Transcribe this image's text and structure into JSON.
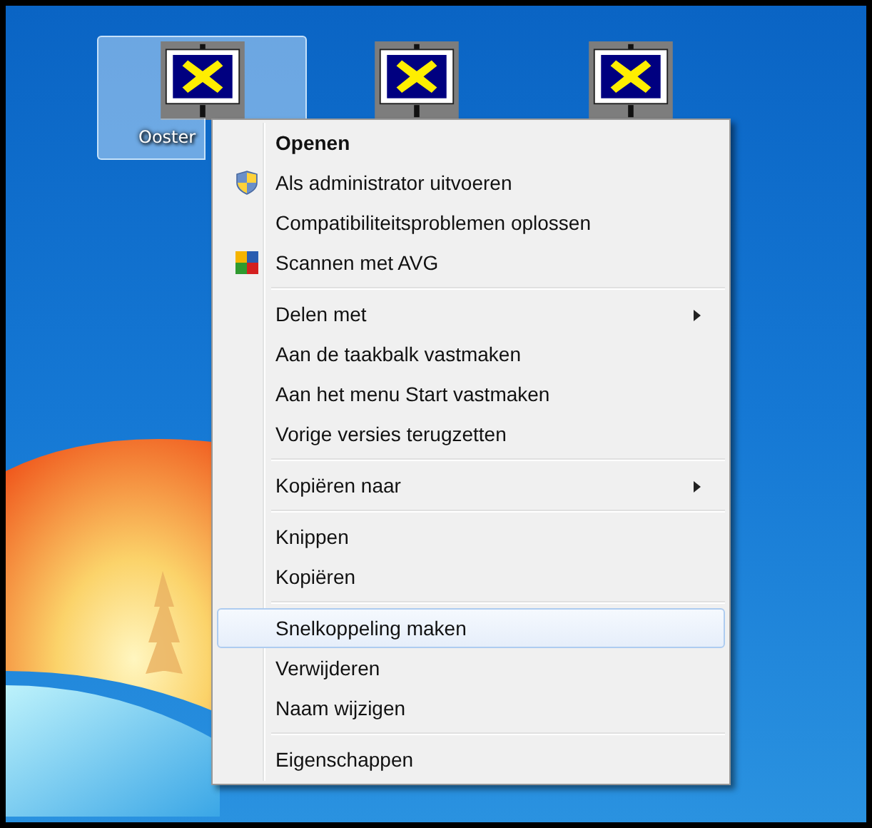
{
  "desktop_icons": [
    {
      "label": "Ooster",
      "selected": true
    },
    {
      "selected": false
    },
    {
      "selected": false
    }
  ],
  "context_menu": {
    "groups": [
      [
        {
          "label": "Openen",
          "kind": "plain",
          "default": true,
          "selected": false
        },
        {
          "label": "Als administrator uitvoeren",
          "kind": "shield",
          "selected": false
        },
        {
          "label": "Compatibiliteitsproblemen oplossen",
          "kind": "plain",
          "selected": false
        },
        {
          "label": "Scannen met AVG",
          "kind": "scan",
          "selected": false
        }
      ],
      [
        {
          "label": "Delen met",
          "kind": "plain",
          "submenu": true,
          "selected": false
        },
        {
          "label": "Aan de taakbalk vastmaken",
          "kind": "plain",
          "selected": false
        },
        {
          "label": "Aan het menu Start vastmaken",
          "kind": "plain",
          "selected": false
        },
        {
          "label": "Vorige versies terugzetten",
          "kind": "plain",
          "selected": false
        }
      ],
      [
        {
          "label": "Kopiëren naar",
          "kind": "plain",
          "submenu": true,
          "selected": false
        }
      ],
      [
        {
          "label": "Knippen",
          "kind": "plain",
          "selected": false
        },
        {
          "label": "Kopiëren",
          "kind": "plain",
          "selected": false
        }
      ],
      [
        {
          "label": "Snelkoppeling maken",
          "kind": "plain",
          "selected": true
        },
        {
          "label": "Verwijderen",
          "kind": "plain",
          "selected": false
        },
        {
          "label": "Naam wijzigen",
          "kind": "plain",
          "selected": false
        }
      ],
      [
        {
          "label": "Eigenschappen",
          "kind": "plain",
          "selected": false
        }
      ]
    ]
  }
}
